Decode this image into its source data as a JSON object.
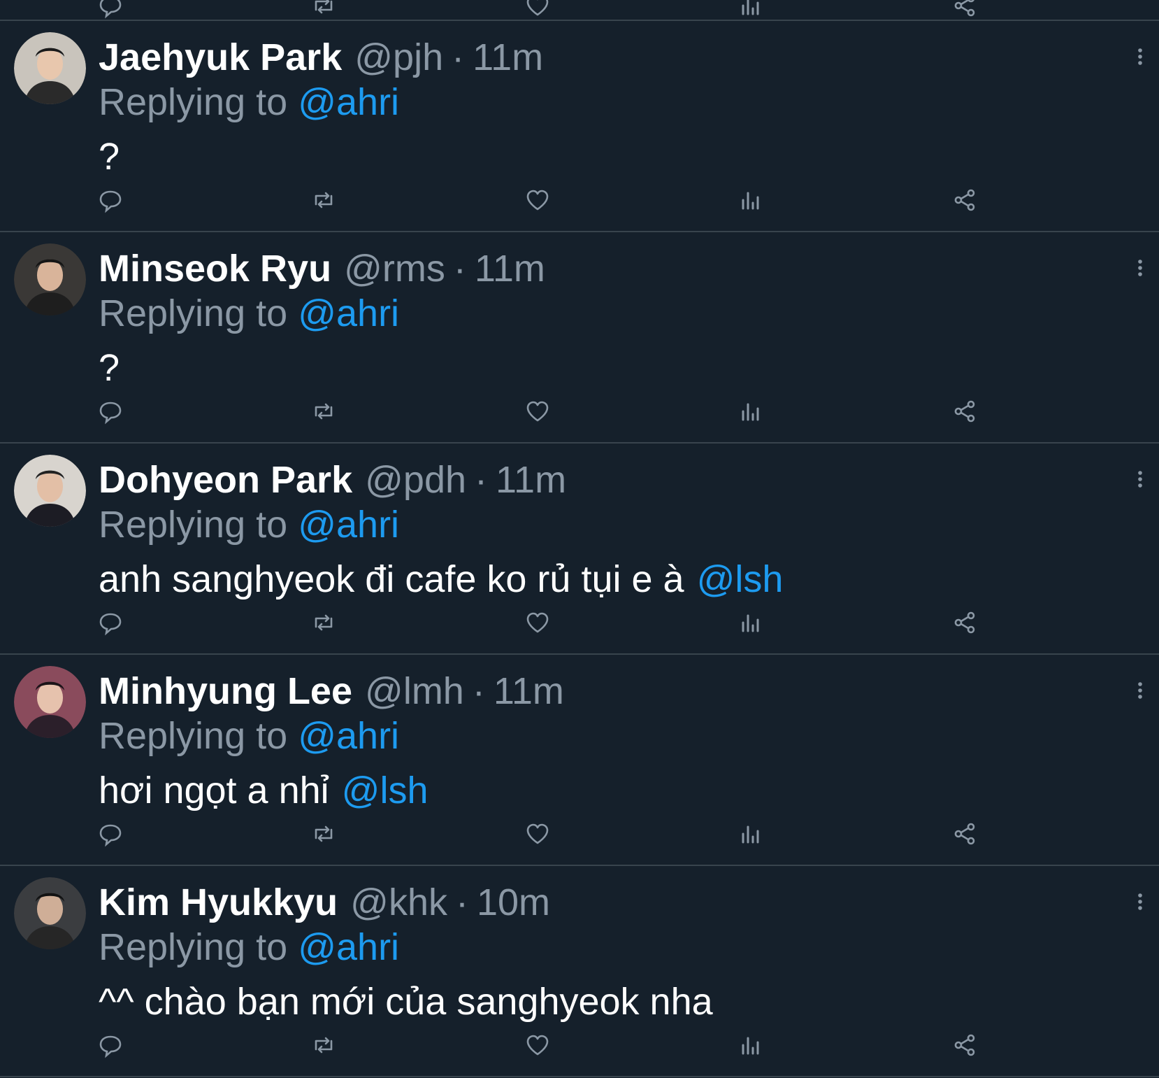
{
  "colors": {
    "background": "#15202b",
    "divider": "#38444d",
    "secondary_text": "#8b98a5",
    "mention": "#1d9bf0",
    "primary_text": "#ffffff"
  },
  "tweets": [
    {
      "name": "Jaehyuk Park",
      "handle": "@pjh",
      "separator": "·",
      "time": "11m",
      "replying_prefix": "Replying to",
      "replying_to": "@ahri",
      "text": "?",
      "text_mention": "",
      "avatar_icon": "avatar-photo"
    },
    {
      "name": "Minseok Ryu",
      "handle": "@rms",
      "separator": "·",
      "time": "11m",
      "replying_prefix": "Replying to",
      "replying_to": "@ahri",
      "text": "?",
      "text_mention": "",
      "avatar_icon": "avatar-photo"
    },
    {
      "name": "Dohyeon Park",
      "handle": "@pdh",
      "separator": "·",
      "time": "11m",
      "replying_prefix": "Replying to",
      "replying_to": "@ahri",
      "text": "anh sanghyeok đi cafe ko rủ tụi e à",
      "text_mention": "@lsh",
      "avatar_icon": "avatar-photo"
    },
    {
      "name": "Minhyung Lee",
      "handle": "@lmh",
      "separator": "·",
      "time": "11m",
      "replying_prefix": "Replying to",
      "replying_to": "@ahri",
      "text": "hơi ngọt a nhỉ",
      "text_mention": "@lsh",
      "avatar_icon": "avatar-photo"
    },
    {
      "name": "Kim Hyukkyu",
      "handle": "@khk",
      "separator": "·",
      "time": "10m",
      "replying_prefix": "Replying to",
      "replying_to": "@ahri",
      "text": "^^ chào bạn mới của sanghyeok nha",
      "text_mention": "",
      "avatar_icon": "avatar-photo"
    }
  ],
  "action_icons": [
    "reply-icon",
    "retweet-icon",
    "like-icon",
    "stats-icon",
    "share-icon"
  ]
}
